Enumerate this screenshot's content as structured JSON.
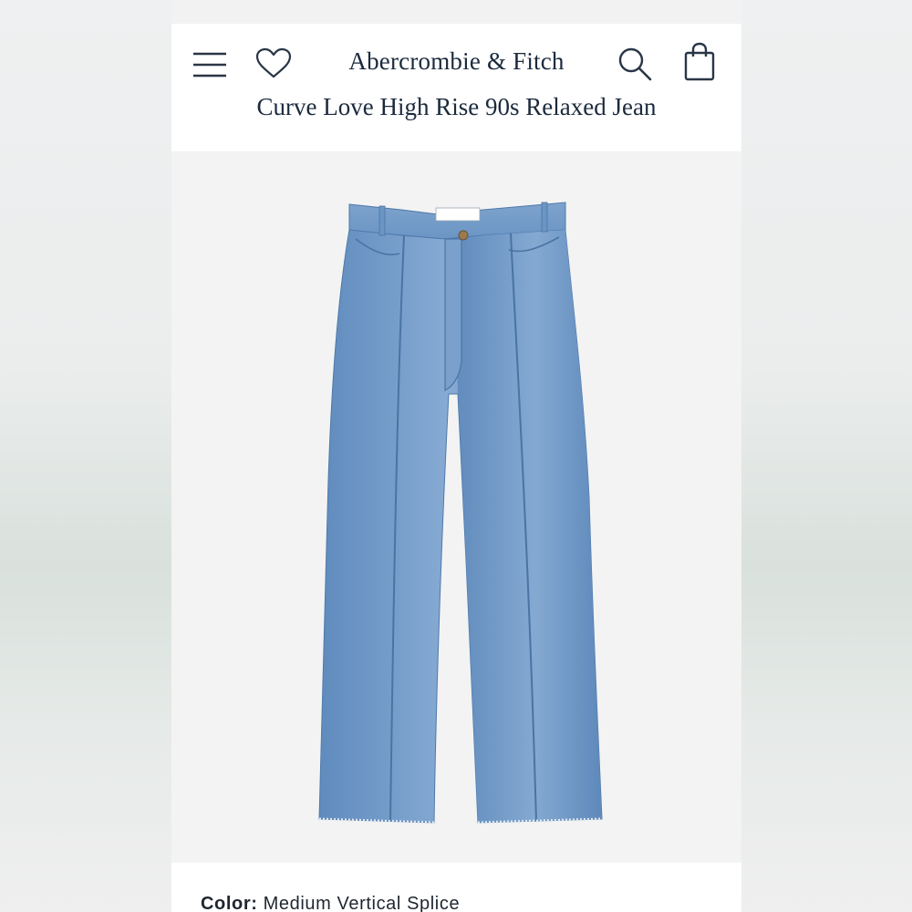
{
  "header": {
    "brand": "Abercrombie & Fitch",
    "menu_icon": "hamburger-menu-icon",
    "wishlist_icon": "heart-icon",
    "search_icon": "search-icon",
    "bag_icon": "shopping-bag-icon"
  },
  "product": {
    "title": "Curve Love High Rise 90s Relaxed Jean",
    "image_subject": "jeans",
    "color_label": "Color:",
    "color_value": "Medium Vertical Splice"
  },
  "colors": {
    "text_primary": "#1b2a3d",
    "denim": "#6f98c7"
  }
}
